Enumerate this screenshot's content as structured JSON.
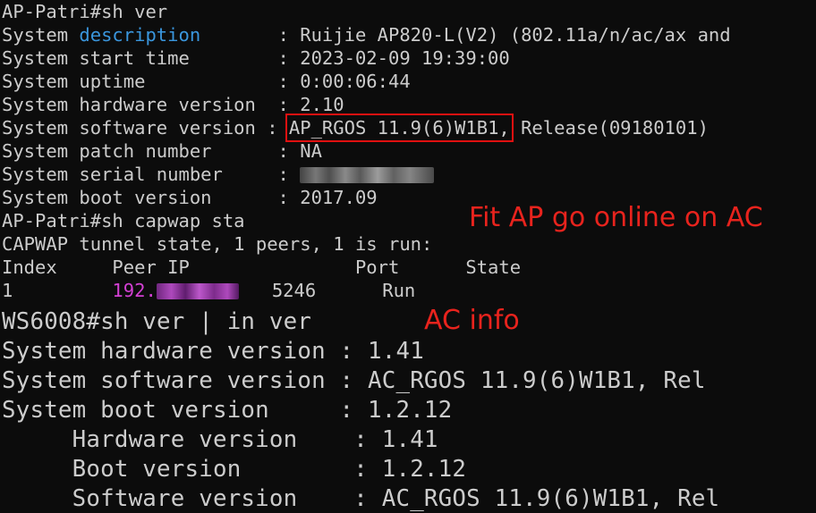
{
  "ap": {
    "cmd_version": "AP-Patri#sh ver",
    "desc_prefix": "System ",
    "desc_word": "description",
    "desc_rest": "       : Ruijie AP820-L(V2) (802.11a/n/ac/ax and",
    "start_time": "System start time        : 2023-02-09 19:39:00",
    "uptime": "System uptime            : 0:00:06:44",
    "hw_version": "System hardware version  : 2.10",
    "sw_prefix": "System software version : ",
    "sw_boxed": "AP_RGOS 11.9(6)W1B1,",
    "sw_rest": " Release(09180101)",
    "patch": "System patch number      : NA",
    "serial_prefix": "System serial number     : ",
    "boot": "System boot version      : 2017.09",
    "cmd_capwap": "AP-Patri#sh capwap sta",
    "capwap_state": "CAPWAP tunnel state, 1 peers, 1 is run:",
    "table_header": "Index     Peer IP               Port      State",
    "row_index": "1         ",
    "row_ip": "192.",
    "row_rest": "   5246      Run"
  },
  "ac": {
    "cmd": "WS6008#sh ver | in ver",
    "hw": "System hardware version : 1.41",
    "sw": "System software version : AC_RGOS 11.9(6)W1B1, Rel",
    "boot": "System boot version     : 1.2.12",
    "hw2": "     Hardware version    : 1.41",
    "boot2": "     Boot version        : 1.2.12",
    "sw2": "     Software version    : AC_RGOS 11.9(6)W1B1, Rel"
  },
  "annotations": {
    "fit_ap": "Fit AP go online on AC",
    "ac_info": "AC info"
  },
  "colors": {
    "background": "#0c0c0c",
    "text": "#cccccc",
    "highlight_cyan": "#3a96dd",
    "ip_magenta": "#d340d3",
    "annotation_red": "#e8231d"
  }
}
